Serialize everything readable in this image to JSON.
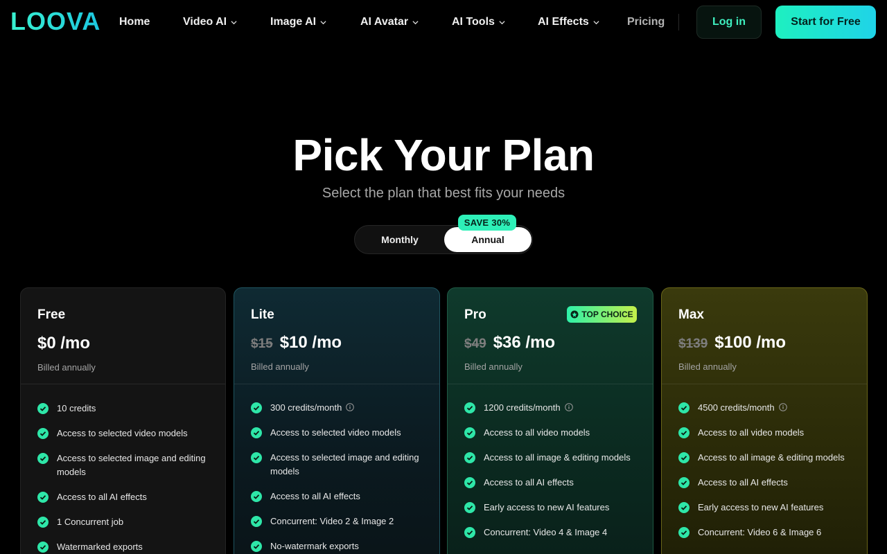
{
  "brand": {
    "name": "LOOVA",
    "accent": "#2ef0b8"
  },
  "nav": {
    "items": [
      {
        "label": "Home",
        "dropdown": false
      },
      {
        "label": "Video AI",
        "dropdown": true
      },
      {
        "label": "Image AI",
        "dropdown": true
      },
      {
        "label": "AI Avatar",
        "dropdown": true
      },
      {
        "label": "AI Tools",
        "dropdown": true
      },
      {
        "label": "AI Effects",
        "dropdown": true
      },
      {
        "label": "Pricing",
        "dropdown": false
      }
    ],
    "login_label": "Log in",
    "start_label": "Start for Free"
  },
  "hero": {
    "title": "Pick Your Plan",
    "subtitle": "Select the plan that best fits your needs"
  },
  "billing": {
    "monthly_label": "Monthly",
    "annual_label": "Annual",
    "selected": "Annual",
    "save_badge": "SAVE 30%"
  },
  "plans": [
    {
      "name": "Free",
      "old_price": "",
      "price": "$0 /mo",
      "billed": "Billed annually",
      "features": [
        "10 credits",
        "Access to selected video models",
        "Access to selected image and editing models",
        "Access to all AI effects",
        "1 Concurrent job",
        "Watermarked exports"
      ]
    },
    {
      "name": "Lite",
      "old_price": "$15",
      "price": "$10 /mo",
      "billed": "Billed annually",
      "features": [
        "300 credits/month",
        "Access to selected video models",
        "Access to selected image and editing models",
        "Access to all AI effects",
        "Concurrent: Video 2 & Image 2",
        "No-watermark exports"
      ]
    },
    {
      "name": "Pro",
      "badge": "TOP CHOICE",
      "old_price": "$49",
      "price": "$36 /mo",
      "billed": "Billed annually",
      "features": [
        "1200 credits/month",
        "Access to all video models",
        "Access to all image & editing models",
        "Access to all AI effects",
        "Early access to new AI features",
        "Concurrent: Video 4 & Image 4"
      ]
    },
    {
      "name": "Max",
      "old_price": "$139",
      "price": "$100 /mo",
      "billed": "Billed annually",
      "features": [
        "4500 credits/month",
        "Access to all video models",
        "Access to all image & editing models",
        "Access to all AI effects",
        "Early access to new AI features",
        "Concurrent: Video 6 & Image 6"
      ]
    }
  ]
}
